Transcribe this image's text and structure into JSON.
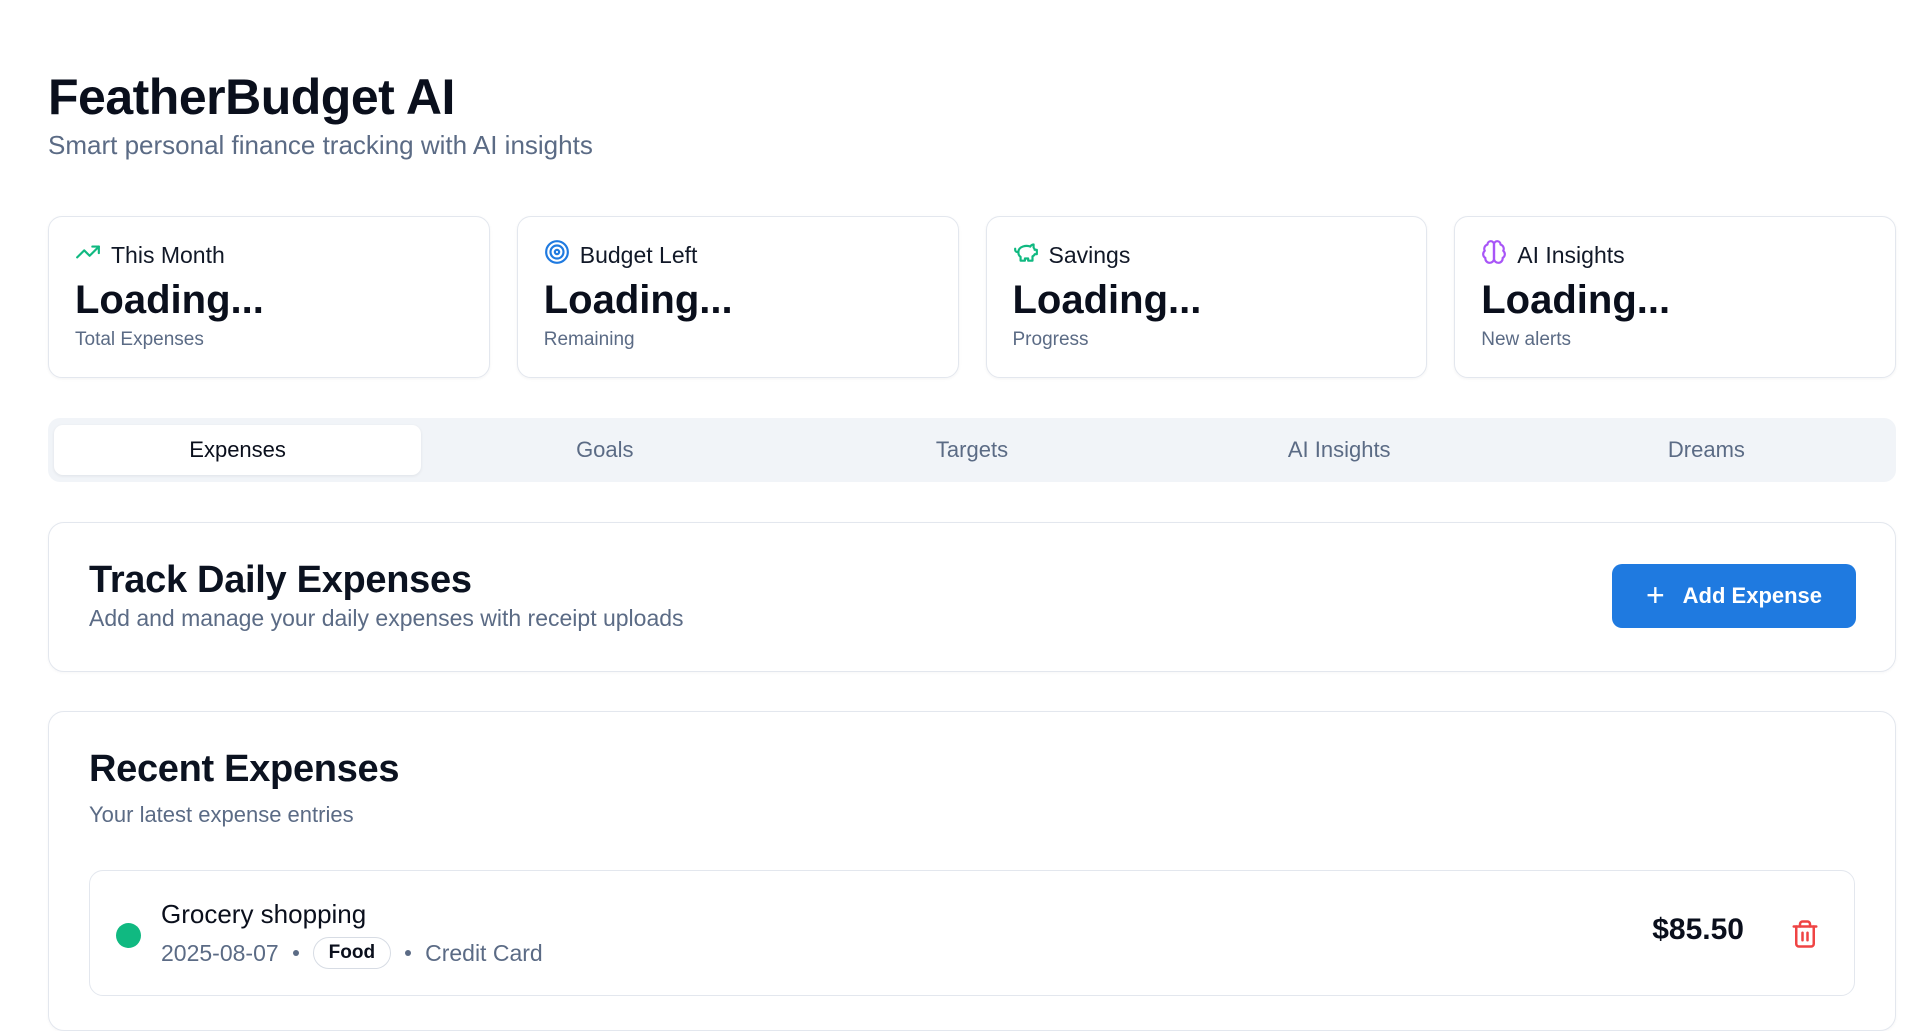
{
  "header": {
    "title": "FeatherBudget AI",
    "subtitle": "Smart personal finance tracking with AI insights"
  },
  "stats": [
    {
      "icon": "trending-up-icon",
      "label": "This Month",
      "value": "Loading...",
      "note": "Total Expenses",
      "color": "#10b981"
    },
    {
      "icon": "target-icon",
      "label": "Budget Left",
      "value": "Loading...",
      "note": "Remaining",
      "color": "#1f7ae0"
    },
    {
      "icon": "piggy-bank-icon",
      "label": "Savings",
      "value": "Loading...",
      "note": "Progress",
      "color": "#10b981"
    },
    {
      "icon": "brain-icon",
      "label": "AI Insights",
      "value": "Loading...",
      "note": "New alerts",
      "color": "#a855f7"
    }
  ],
  "tabs": [
    {
      "label": "Expenses",
      "active": true
    },
    {
      "label": "Goals",
      "active": false
    },
    {
      "label": "Targets",
      "active": false
    },
    {
      "label": "AI Insights",
      "active": false
    },
    {
      "label": "Dreams",
      "active": false
    }
  ],
  "track": {
    "title": "Track Daily Expenses",
    "subtitle": "Add and manage your daily expenses with receipt uploads",
    "add_button": "Add Expense",
    "add_button_icon": "plus-icon"
  },
  "recent": {
    "title": "Recent Expenses",
    "subtitle": "Your latest expense entries",
    "items": [
      {
        "title": "Grocery shopping",
        "date": "2025-08-07",
        "category": "Food",
        "payment": "Credit Card",
        "amount": "$85.50",
        "dot_color": "#10b981",
        "delete_icon": "trash-icon"
      }
    ]
  },
  "colors": {
    "accent": "#1f7ae0",
    "danger": "#ef4444",
    "muted": "#5b6b85"
  }
}
